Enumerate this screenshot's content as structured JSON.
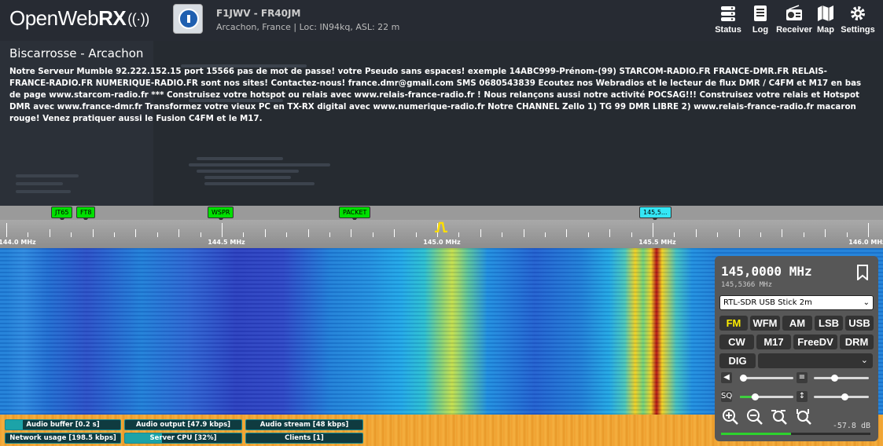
{
  "header": {
    "logo_text": "OpenWeb",
    "logo_bold": "RX",
    "receiver_callsign": "F1JWV - FR40JM",
    "receiver_location": "Arcachon, France | Loc: IN94kq, ASL: 22 m",
    "buttons": [
      {
        "label": "Status",
        "icon": "status-icon"
      },
      {
        "label": "Log",
        "icon": "log-icon"
      },
      {
        "label": "Receiver",
        "icon": "receiver-icon"
      },
      {
        "label": "Map",
        "icon": "map-icon"
      },
      {
        "label": "Settings",
        "icon": "gear-icon"
      }
    ]
  },
  "description": {
    "title": "Biscarrosse - Arcachon",
    "text": "Notre Serveur Mumble 92.222.152.15 port 15566 pas de mot de passe! votre Pseudo sans espaces! exemple 14ABC999-Prénom-(99) STARCOM-RADIO.FR FRANCE-DMR.FR RELAIS-FRANCE-RADIO.FR NUMERIQUE-RADIO.FR sont nos sites! Contactez-nous! france.dmr@gmail.com SMS 0680543839 Ecoutez nos Webradios et le lecteur de flux DMR / C4FM et M17 en bas de page www.starcom-radio.fr *** Construisez votre hotspot ou relais avec www.relais-france-radio.fr ! Nous relançons aussi notre activité POCSAG!!! Construisez votre relais et Hotspot DMR avec www.france-dmr.fr Transformez votre vieux PC en TX-RX digital avec www.numerique-radio.fr Notre CHANNEL Zello 1) TG 99 DMR LIBRE 2) www.relais-france-radio.fr macaron rouge! Venez pratiquer aussi le Fusion C4FM et le M17."
  },
  "bookmarks": [
    {
      "label": "JT65",
      "color": "green"
    },
    {
      "label": "FT8",
      "color": "green"
    },
    {
      "label": "WSPR",
      "color": "green"
    },
    {
      "label": "PACKET",
      "color": "green"
    },
    {
      "label": "145,5...",
      "color": "cyan"
    }
  ],
  "scale": {
    "labels": [
      "144.0 MHz",
      "144.5 MHz",
      "145.0 MHz",
      "145.5 MHz",
      "146.0 MHz"
    ]
  },
  "status_bars": [
    {
      "label": "Audio buffer [0.2 s]",
      "level": 0.15
    },
    {
      "label": "Audio output [47.9 kbps]",
      "level": 0.0
    },
    {
      "label": "Audio stream [48 kbps]",
      "level": 0.0
    },
    {
      "label": "Network usage [198.5 kbps]",
      "level": 0.0
    },
    {
      "label": "Server CPU [32%]",
      "level": 0.32
    },
    {
      "label": "Clients [1]",
      "level": 0.0
    }
  ],
  "panel": {
    "frequency": "145,0000 MHz",
    "offset_frequency": "145,5366 MHz",
    "sdr_profile": "RTL-SDR USB Stick 2m",
    "modes_row1": [
      "FM",
      "WFM",
      "AM",
      "LSB",
      "USB"
    ],
    "modes_row2": [
      "CW",
      "M17",
      "FreeDV",
      "DRM"
    ],
    "dig_label": "DIG",
    "dig_selected": "",
    "active_mode": "FM",
    "volume_level": 0.0,
    "squelch_level": 0.25,
    "db_reading": "-57.8 dB",
    "smeter_level": 0.47,
    "colors": {
      "panel": "#575757",
      "accent": "#ffee00",
      "meter": "#2dd22d"
    }
  }
}
